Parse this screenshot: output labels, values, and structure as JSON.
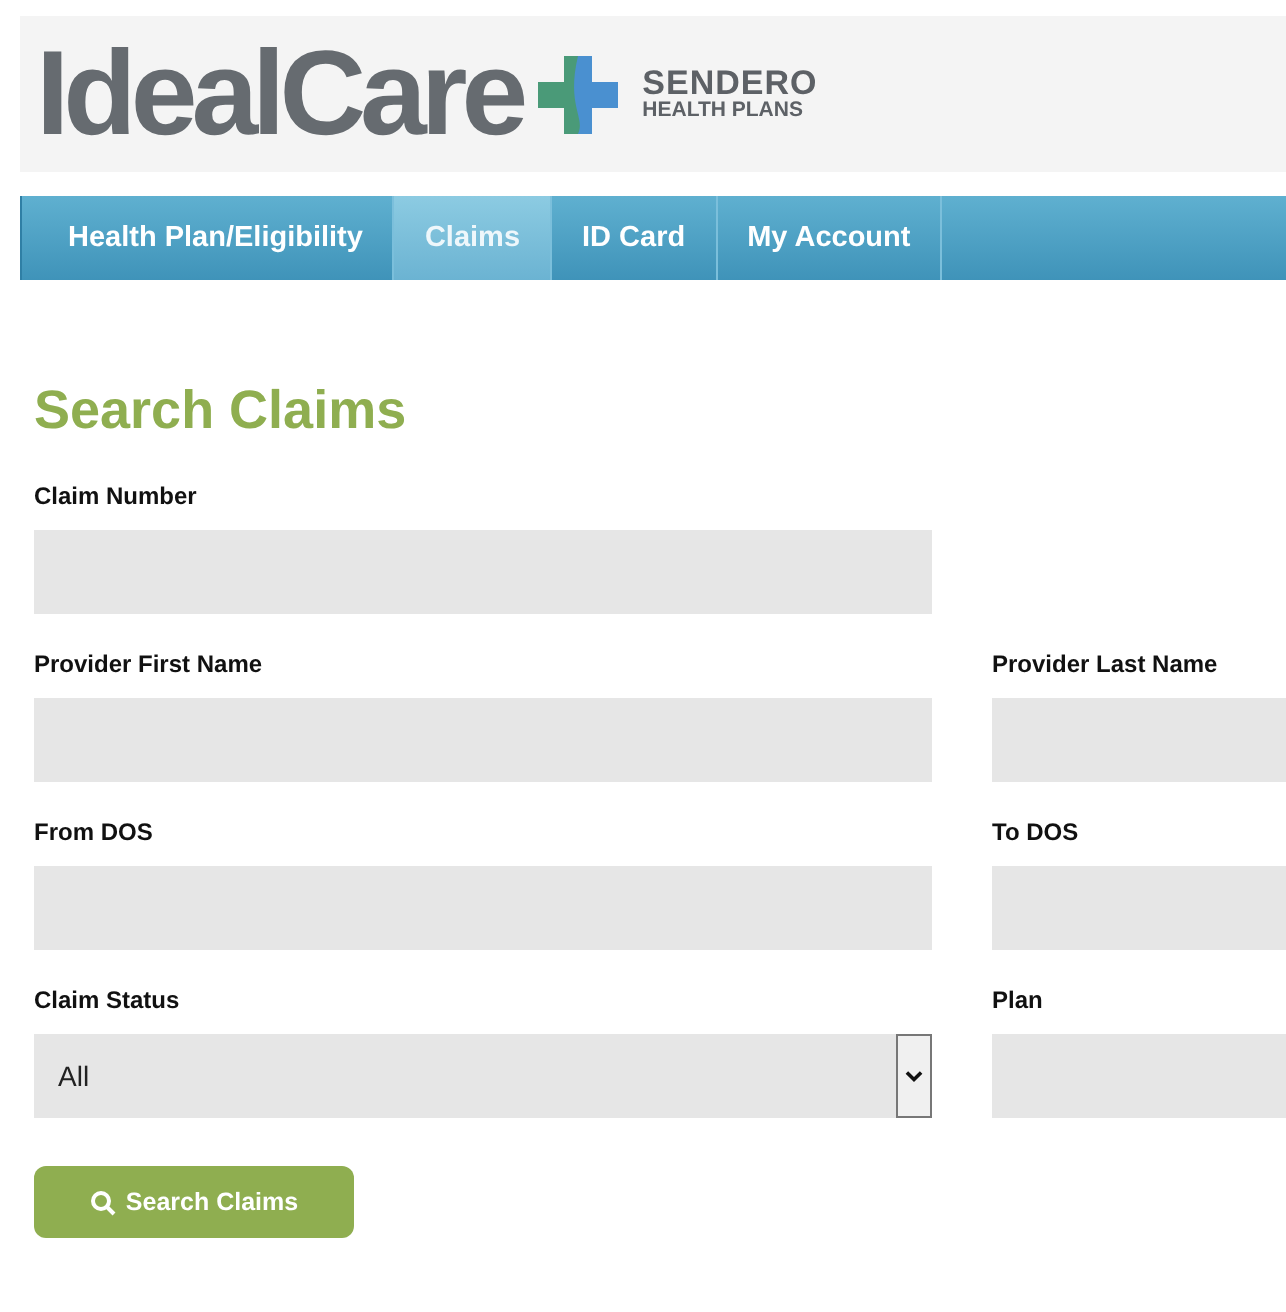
{
  "header": {
    "brand": "IdealCare",
    "partner_name": "SENDERO",
    "partner_tagline": "HEALTH PLANS"
  },
  "nav": [
    {
      "label": "Health Plan/Eligibility",
      "selected": false
    },
    {
      "label": "Claims",
      "selected": true
    },
    {
      "label": "ID Card",
      "selected": false
    },
    {
      "label": "My Account",
      "selected": false
    }
  ],
  "form": {
    "title": "Search Claims",
    "rows": [
      [
        {
          "label": "Claim Number",
          "kind": "text"
        }
      ],
      [
        {
          "label": "Provider First Name",
          "kind": "text"
        },
        {
          "label": "Provider Last Name",
          "kind": "text"
        }
      ],
      [
        {
          "label": "From DOS",
          "kind": "text"
        },
        {
          "label": "To DOS",
          "kind": "text"
        }
      ],
      [
        {
          "label": "Claim Status",
          "kind": "select",
          "value": "All"
        },
        {
          "label": "Plan",
          "kind": "text"
        }
      ]
    ],
    "submit": "Search Claims"
  }
}
